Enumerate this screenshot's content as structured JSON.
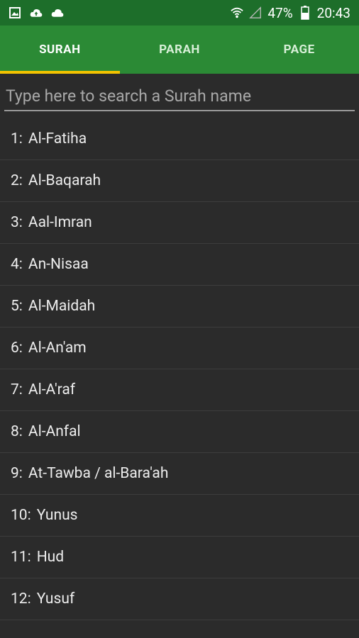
{
  "status_bar": {
    "battery": "47%",
    "time": "20:43",
    "icons": [
      "image-icon",
      "cloud-upload-icon",
      "cloud-icon",
      "wifi-icon",
      "signal-icon",
      "battery-icon"
    ]
  },
  "tabs": [
    {
      "label": "SURAH",
      "active": true
    },
    {
      "label": "PARAH",
      "active": false
    },
    {
      "label": "PAGE",
      "active": false
    }
  ],
  "search": {
    "placeholder": "Type here to search a Surah name",
    "value": ""
  },
  "surahs": [
    {
      "number": "1:",
      "name": "Al-Fatiha"
    },
    {
      "number": "2:",
      "name": "Al-Baqarah"
    },
    {
      "number": "3:",
      "name": "Aal-Imran"
    },
    {
      "number": "4:",
      "name": "An-Nisaa"
    },
    {
      "number": "5:",
      "name": "Al-Maidah"
    },
    {
      "number": "6:",
      "name": "Al-An'am"
    },
    {
      "number": "7:",
      "name": "Al-A'raf"
    },
    {
      "number": "8:",
      "name": "Al-Anfal"
    },
    {
      "number": "9:",
      "name": "At-Tawba / al-Bara'ah"
    },
    {
      "number": "10:",
      "name": "Yunus"
    },
    {
      "number": "11:",
      "name": "Hud"
    },
    {
      "number": "12:",
      "name": "Yusuf"
    }
  ],
  "colors": {
    "status_bar": "#1d6e2a",
    "tab_bar": "#2b8a35",
    "tab_indicator": "#f2c200",
    "background": "#2b2b2b"
  }
}
